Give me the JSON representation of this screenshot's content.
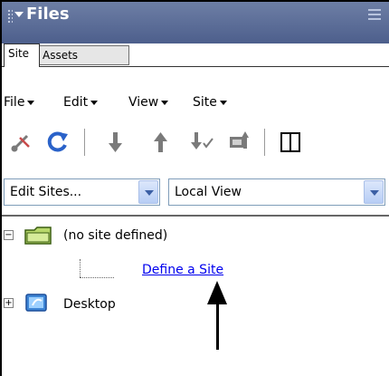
{
  "panel": {
    "title": "Files",
    "tabs": [
      {
        "label": "Site",
        "active": true
      },
      {
        "label": "Assets",
        "active": false
      }
    ]
  },
  "menu": {
    "items": [
      "File",
      "Edit",
      "View",
      "Site"
    ]
  },
  "toolbar": {
    "icons": [
      "connect-icon",
      "refresh-icon",
      "get-files-icon",
      "put-files-icon",
      "check-out-icon",
      "check-in-icon",
      "expand-icon"
    ]
  },
  "site_select": {
    "value": "Edit Sites..."
  },
  "view_select": {
    "value": "Local View"
  },
  "tree": {
    "root_label": "(no site defined)",
    "child_link": "Define a Site",
    "desktop_label": "Desktop"
  },
  "colors": {
    "title_bar": "#5a6c97",
    "link": "#0000ee",
    "folder": "#b8d86b"
  }
}
